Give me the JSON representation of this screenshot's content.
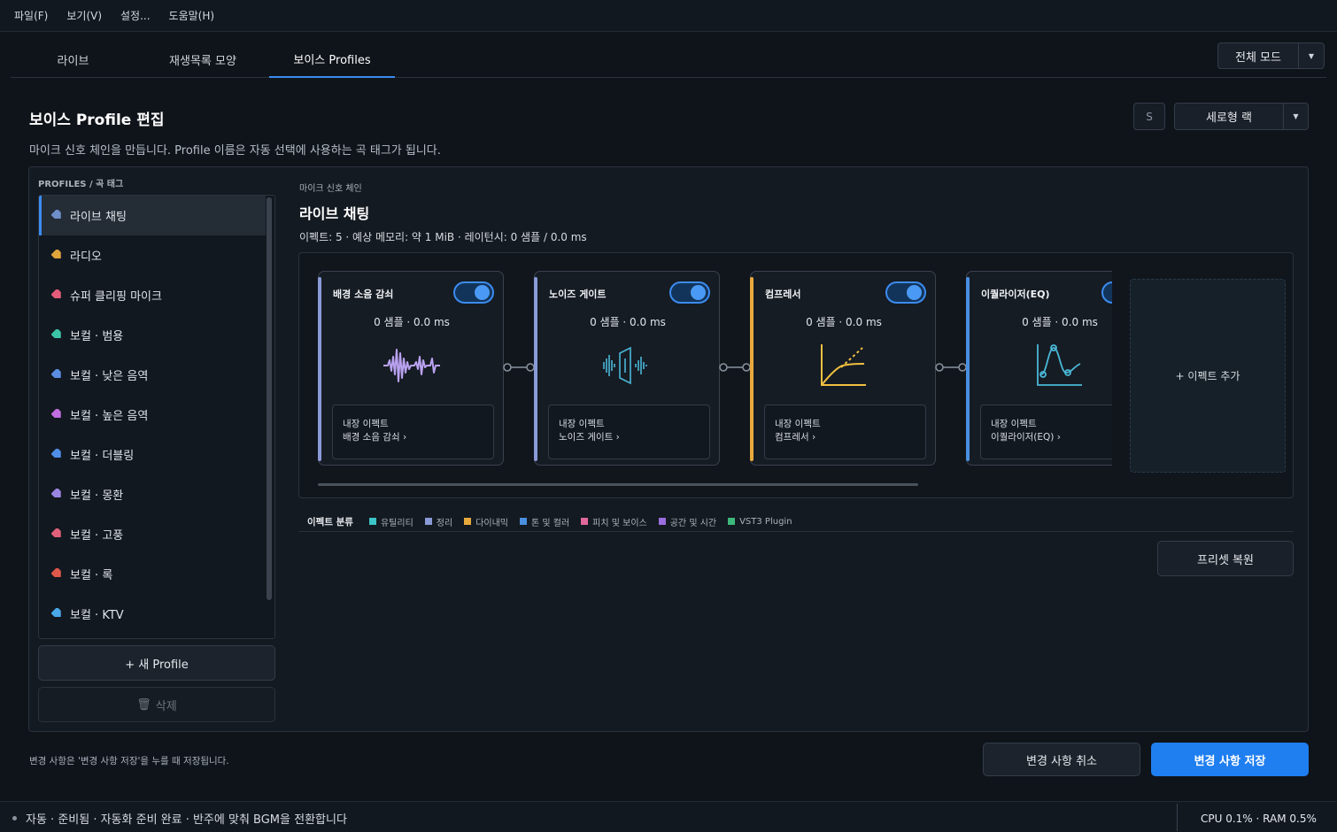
{
  "menu": [
    "파일(F)",
    "보기(V)",
    "설정...",
    "도움말(H)"
  ],
  "tabs": [
    {
      "label": "라이브"
    },
    {
      "label": "재생목록 모양"
    },
    {
      "label": "보이스 Profiles",
      "active": true
    }
  ],
  "fullmode": {
    "label": "전체 모드"
  },
  "page": {
    "title": "보이스 Profile 편집",
    "description": "마이크 신호 체인을 만듭니다. Profile 이름은 자동 선택에 사용하는 곡 태그가 됩니다.",
    "s_button": "S",
    "layout_select": "세로형 랙"
  },
  "profiles": {
    "label": "PROFILES / 곡 태그",
    "items": [
      {
        "label": "라이브 채팅",
        "color": "#6f8fc9",
        "active": true
      },
      {
        "label": "라디오",
        "color": "#e0a43c"
      },
      {
        "label": "슈퍼 클리핑 마이크",
        "color": "#e45c7a"
      },
      {
        "label": "보컬 · 범용",
        "color": "#3cc4a8"
      },
      {
        "label": "보컬 · 낮은 음역",
        "color": "#5b8ee0"
      },
      {
        "label": "보컬 · 높은 음역",
        "color": "#c06ee0"
      },
      {
        "label": "보컬 · 더블링",
        "color": "#4f8fe8"
      },
      {
        "label": "보컬 · 몽환",
        "color": "#9a86e0"
      },
      {
        "label": "보컬 · 고풍",
        "color": "#e0607a"
      },
      {
        "label": "보컬 · 록",
        "color": "#e0584a"
      },
      {
        "label": "보컬 · KTV",
        "color": "#4aa8e8"
      }
    ],
    "new_button": "+ 새 Profile",
    "delete_button": "삭제"
  },
  "chain": {
    "label": "마이크 신호 체인",
    "title": "라이브 채팅",
    "stats": "이펙트: 5 · 예상 메모리: 약 1 MiB · 레이턴시: 0 샘플 / 0.0 ms",
    "cards": [
      {
        "name": "배경 소음 감쇠",
        "latency": "0 샘플 · 0.0 ms",
        "sub_title": "내장 이펙트",
        "sub_name": "배경 소음 감쇠",
        "accent": "#8a9ad6",
        "icon": "waveform-icon",
        "enabled": true
      },
      {
        "name": "노이즈 게이트",
        "latency": "0 샘플 · 0.0 ms",
        "sub_title": "내장 이펙트",
        "sub_name": "노이즈 게이트",
        "accent": "#8a9ad6",
        "icon": "gate-icon",
        "enabled": true
      },
      {
        "name": "컴프레서",
        "latency": "0 샘플 · 0.0 ms",
        "sub_title": "내장 이펙트",
        "sub_name": "컴프레서",
        "accent": "#e8a93c",
        "icon": "compressor-curve-icon",
        "enabled": true
      },
      {
        "name": "이퀄라이저(EQ)",
        "latency": "0 샘플 · 0.0 ms",
        "sub_title": "내장 이펙트",
        "sub_name": "이퀄라이저(EQ)",
        "accent": "#4a8fe0",
        "icon": "eq-curve-icon",
        "enabled": true
      }
    ],
    "add_effect": "+ 이펙트 추가"
  },
  "legend": {
    "title": "이펙트 분류",
    "items": [
      {
        "label": "유틸리티",
        "color": "#3cc4c8"
      },
      {
        "label": "정리",
        "color": "#8a9ad6"
      },
      {
        "label": "다이내믹",
        "color": "#e8a93c"
      },
      {
        "label": "톤 및 컬러",
        "color": "#4a8fe0"
      },
      {
        "label": "피치 및 보이스",
        "color": "#e0689a"
      },
      {
        "label": "공간 및 시간",
        "color": "#9a6ee0"
      },
      {
        "label": "VST3 Plugin",
        "color": "#3cb87a"
      }
    ]
  },
  "preset_restore": "프리셋 복원",
  "footer": {
    "note": "변경 사항은 '변경 사항 저장'을 누를 때 저장됩니다.",
    "cancel": "변경 사항 취소",
    "save": "변경 사항 저장"
  },
  "status": {
    "message": "자동 · 준비됨 · 자동화 준비 완료 · 반주에 맞춰 BGM을 전환합니다",
    "resources": "CPU 0.1% · RAM 0.5%"
  }
}
